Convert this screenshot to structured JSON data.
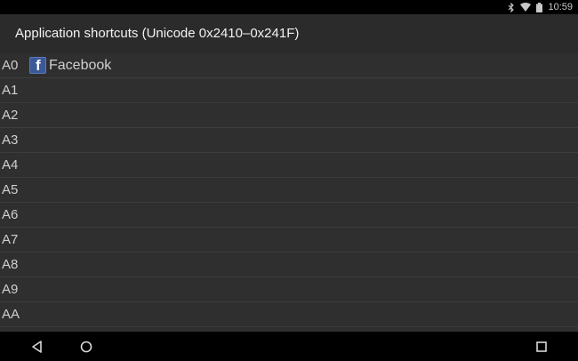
{
  "status_bar": {
    "time": "10:59",
    "icons": [
      "bluetooth-icon",
      "wifi-icon",
      "battery-icon"
    ]
  },
  "action_bar": {
    "title": "Application shortcuts (Unicode 0x2410–0x241F)"
  },
  "shortcuts": [
    {
      "code": "A0",
      "app": "Facebook",
      "icon": "facebook-icon"
    },
    {
      "code": "A1",
      "app": ""
    },
    {
      "code": "A2",
      "app": ""
    },
    {
      "code": "A3",
      "app": ""
    },
    {
      "code": "A4",
      "app": ""
    },
    {
      "code": "A5",
      "app": ""
    },
    {
      "code": "A6",
      "app": ""
    },
    {
      "code": "A7",
      "app": ""
    },
    {
      "code": "A8",
      "app": ""
    },
    {
      "code": "A9",
      "app": ""
    },
    {
      "code": "AA",
      "app": ""
    }
  ],
  "nav_bar": {
    "icons": [
      "back-icon",
      "home-icon",
      "recents-icon"
    ]
  },
  "colors": {
    "action_bar": "#2b2b2b",
    "list_background": "#2f2f2f",
    "facebook_blue": "#3b5998"
  }
}
